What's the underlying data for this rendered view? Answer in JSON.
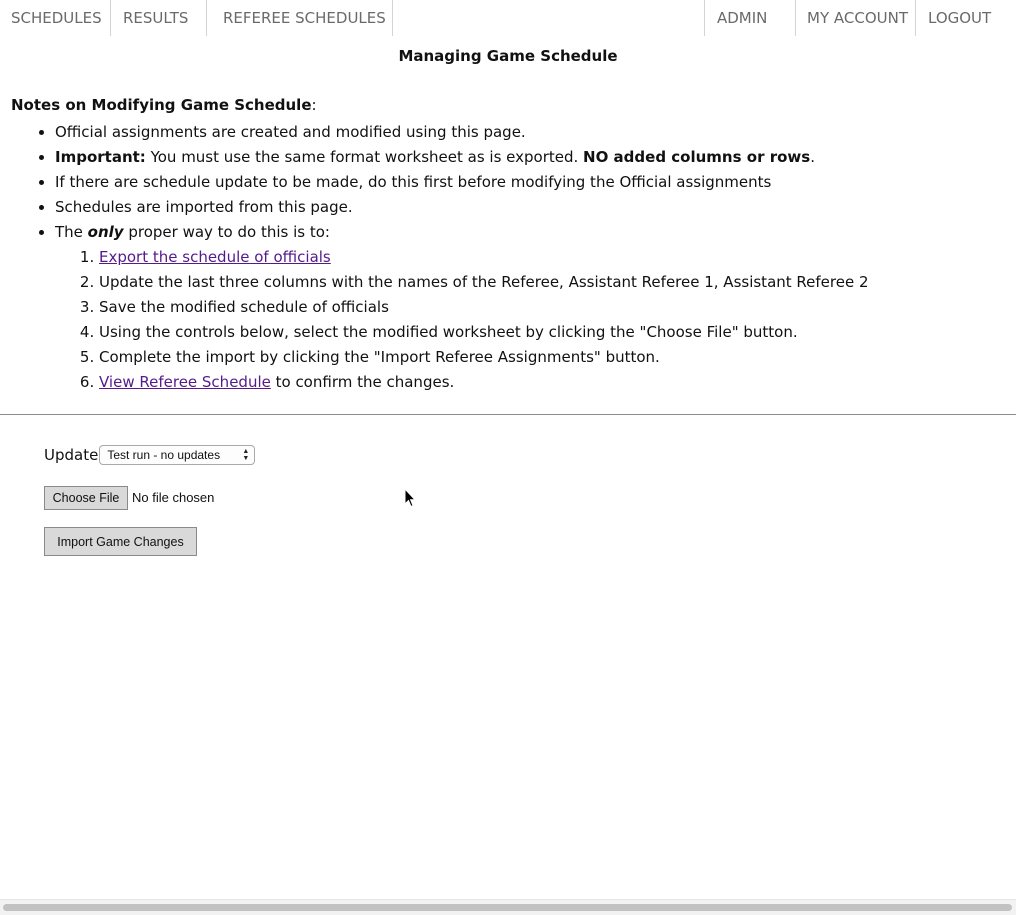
{
  "nav": {
    "schedules": "SCHEDULES",
    "results": "RESULTS",
    "referee_schedules": "REFEREE SCHEDULES",
    "admin": "ADMIN",
    "my_account": "MY ACCOUNT",
    "logout": "LOGOUT"
  },
  "page_title": "Managing Game Schedule",
  "notes": {
    "title": "Notes on Modifying Game Schedule",
    "title_colon": ":",
    "bullet1": "Official assignments are created and modified using this page.",
    "bullet2_strong": "Important:",
    "bullet2_text": " You must use the same format worksheet as is exported. ",
    "bullet2_strong2": "NO added columns or rows",
    "bullet2_end": ".",
    "bullet3": "If there are schedule update to be made, do this first before modifying the Official assignments",
    "bullet4": "Schedules are imported from this page.",
    "bullet5_pre": "The ",
    "bullet5_em": "only",
    "bullet5_post": " proper way to do this is to:",
    "steps": {
      "s1_link": "Export the schedule of officials",
      "s2": "Update the last three columns with the names of the Referee, Assistant Referee 1, Assistant Referee 2",
      "s3": "Save the modified schedule of officials",
      "s4": "Using the controls below, select the modified worksheet by clicking the \"Choose File\" button.",
      "s5": "Complete the import by clicking the \"Import Referee Assignments\" button.",
      "s6_link": "View Referee Schedule",
      "s6_post": " to confirm the changes."
    }
  },
  "form": {
    "update_label": "Update",
    "update_selected": "Test run - no updates",
    "choose_file_label": "Choose File",
    "file_status": "No file chosen",
    "import_button": "Import Game Changes"
  },
  "icons": {
    "select_arrows": "up-down-arrows-icon",
    "cursor": "mouse-pointer-icon"
  },
  "colors": {
    "link": "#551a8b",
    "nav_text": "#6a6a6a",
    "button_bg": "#d9d9d9"
  }
}
